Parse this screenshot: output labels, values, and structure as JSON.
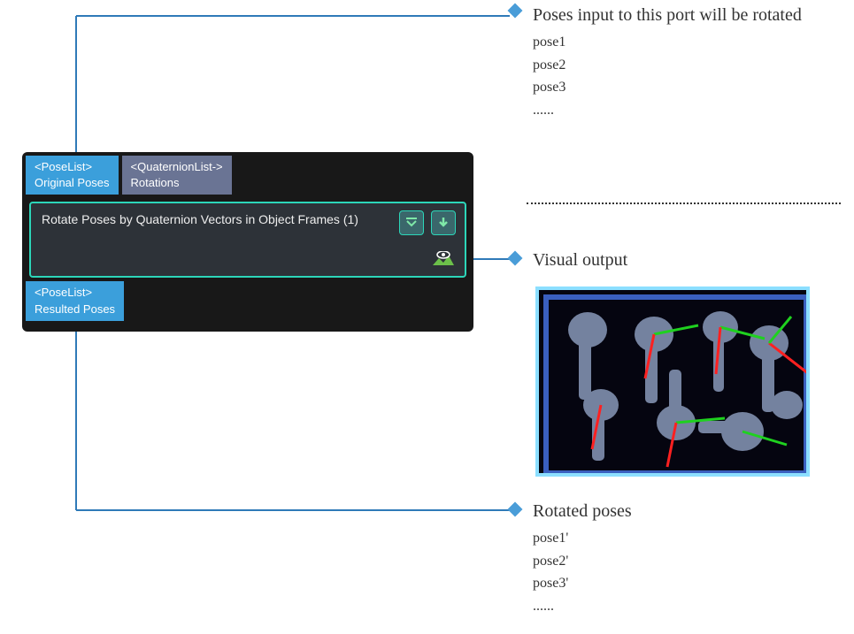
{
  "annotations": {
    "input": {
      "title": "Poses input to this port will be rotated",
      "items": [
        "pose1",
        "pose2",
        "pose3",
        "......"
      ]
    },
    "visual": {
      "title": "Visual output"
    },
    "output": {
      "title": "Rotated poses",
      "items": [
        "pose1'",
        "pose2'",
        "pose3'",
        "......"
      ]
    }
  },
  "node": {
    "title": "Rotate Poses by Quaternion Vectors in Object Frames (1)",
    "ports": {
      "in1": {
        "type": "<PoseList>",
        "label": "Original Poses"
      },
      "in2": {
        "type": "<QuaternionList->",
        "label": "Rotations"
      },
      "out1": {
        "type": "<PoseList>",
        "label": "Resulted Poses"
      }
    }
  }
}
